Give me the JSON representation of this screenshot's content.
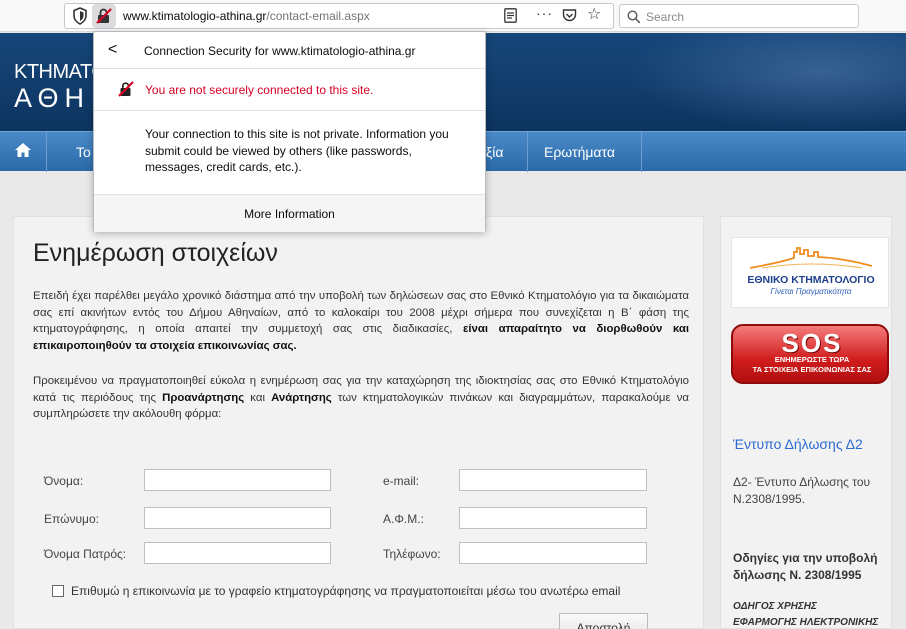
{
  "browser": {
    "url_host": "www.ktimatologio-athina.gr",
    "url_path": "/contact-email.aspx",
    "search_placeholder": "Search",
    "more_label": "···"
  },
  "popup": {
    "back_label": "<",
    "title": "Connection Security for www.ktimatologio-athina.gr",
    "warning": "You are not securely connected to this site.",
    "body": "Your connection to this site is not private. Information you submit could be viewed by others (like passwords, messages, credit cards, etc.).",
    "more_info": "More Information"
  },
  "site": {
    "brand_line1": "ΚΤΗΜΑΤΟ",
    "brand_line2": "ΑΘΗ",
    "nav": [
      "Το",
      "ξία",
      "Ερωτήματα"
    ]
  },
  "main": {
    "title": "Ενημέρωση στοιχείων",
    "para1_a": "Επειδή έχει παρέλθει μεγάλο χρονικό διάστημα από την υποβολή των δηλώσεων σας στο Εθνικό Κτηματολόγιο για τα δικαιώματα σας επί ακινήτων εντός του Δήμου Αθηναίων, από το καλοκαίρι του 2008 μέχρι σήμερα που συνεχίζεται η Β΄ φάση της κτηματογράφησης, η οποία απαιτεί την συμμετοχή σας στις διαδικασίες, ",
    "para1_b": "είναι απαραίτητο να διορθωθούν και επικαιροποιηθούν τα στοιχεία επικοινωνίας σας.",
    "para2_a": "Προκειμένου να πραγματοποιηθεί εύκολα η ενημέρωση σας για την καταχώρηση της ιδιοκτησίας σας στο Εθνικό Κτηματολόγιο κατά τις περιόδους της ",
    "para2_b": "Προανάρτησης",
    "para2_c": " και ",
    "para2_d": "Ανάρτησης",
    "para2_e": " των κτηματολογικών πινάκων και διαγραμμάτων, παρακαλούμε να συμπληρώσετε την ακόλουθη φόρμα:",
    "form": {
      "first_name": "Όνομα:",
      "last_name": "Επώνυμο:",
      "father_name": "Όνομα Πατρός:",
      "email": "e-mail:",
      "afm": "Α.Φ.Μ.:",
      "phone": "Τηλέφωνο:",
      "consent": "Επιθυμώ η επικοινωνία με το γραφείο κτηματογράφησης να πραγματοποιείται μέσω του ανωτέρω email",
      "submit": "Αποστολή"
    }
  },
  "sidebar": {
    "logo_title": "ΕΘΝΙΚΟ ΚΤΗΜΑΤΟΛΟΓΙΟ",
    "logo_slogan": "Γίνεται Πραγματικότητα",
    "sos_big": "SOS",
    "sos_line1": "ΕΝΗΜΕΡΩΣΤΕ ΤΩΡΑ",
    "sos_line2": "ΤΑ ΣΤΟΙΧΕΙΑ ΕΠΙΚΟΙΝΩΝΙΑΣ ΣΑΣ",
    "form_link": "Έντυπο Δήλωσης Δ2",
    "form_desc": "Δ2- Έντυπο Δήλωσης του Ν.2308/1995.",
    "guide_title": "Οδηγίες για την υποβολή δήλωσης Ν. 2308/1995",
    "manual_line1": "ΟΔΗΓΟΣ ΧΡΗΣΗΣ",
    "manual_line2": "ΕΦΑΡΜΟΓΗΣ ΗΛΕΚΤΡΟΝΙΚΗΣ"
  }
}
